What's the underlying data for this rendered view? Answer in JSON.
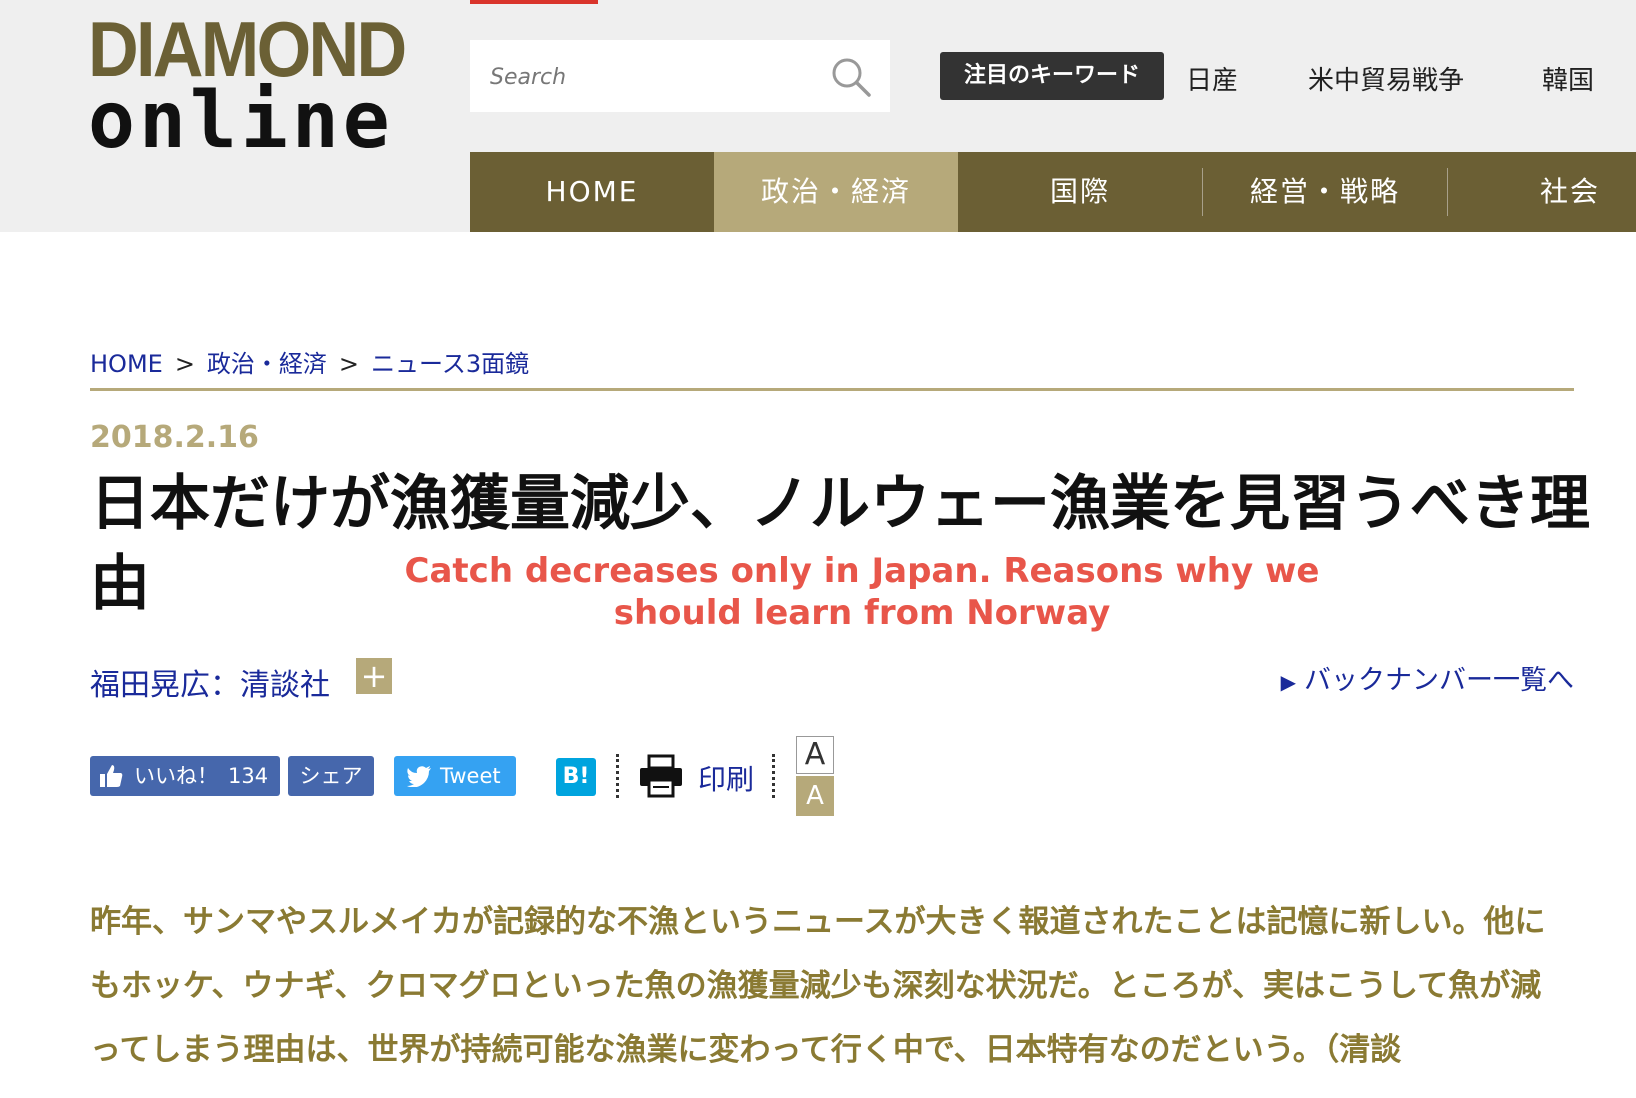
{
  "logo": {
    "line1": "DIAMOND",
    "line2": "online"
  },
  "search": {
    "placeholder": "Search"
  },
  "keywords": {
    "label": "注目のキーワード",
    "items": [
      "日産",
      "米中貿易戦争",
      "韓国"
    ]
  },
  "nav": {
    "items": [
      "HOME",
      "政治・経済",
      "国際",
      "経営・戦略",
      "社会"
    ],
    "active": "政治・経済"
  },
  "breadcrumb": {
    "items": [
      "HOME",
      "政治・経済",
      "ニュース3面鏡"
    ],
    "separator": ">"
  },
  "article": {
    "date": "2018.2.16",
    "title": "日本だけが漁獲量減少、ノルウェー漁業を見習うべき理由",
    "translation": "Catch decreases only in Japan. Reasons why we should learn from Norway",
    "author": "福田晃広：清談社",
    "plus": "+",
    "backnumber": "バックナンバー一覧へ",
    "lead": "昨年、サンマやスルメイカが記録的な不漁というニュースが大きく報道されたことは記憶に新しい。他にもホッケ、ウナギ、クロマグロといった魚の漁獲量減少も深刻な状況だ。ところが、実はこうして魚が減ってしまう理由は、世界が持続可能な漁業に変わって行く中で、日本特有なのだという。（清談"
  },
  "social": {
    "like_label": "いいね！",
    "like_count": "134",
    "share_label": "シェア",
    "tweet_label": "Tweet",
    "hatena_label": "B!",
    "print_label": "印刷",
    "font_large": "A",
    "font_small": "A"
  },
  "colors": {
    "brand_olive": "#6b5f34",
    "accent_gold": "#b6a97a",
    "link_blue": "#1a2a9a",
    "annotation_red": "#e8564a",
    "lead_text": "#8a7a33"
  }
}
